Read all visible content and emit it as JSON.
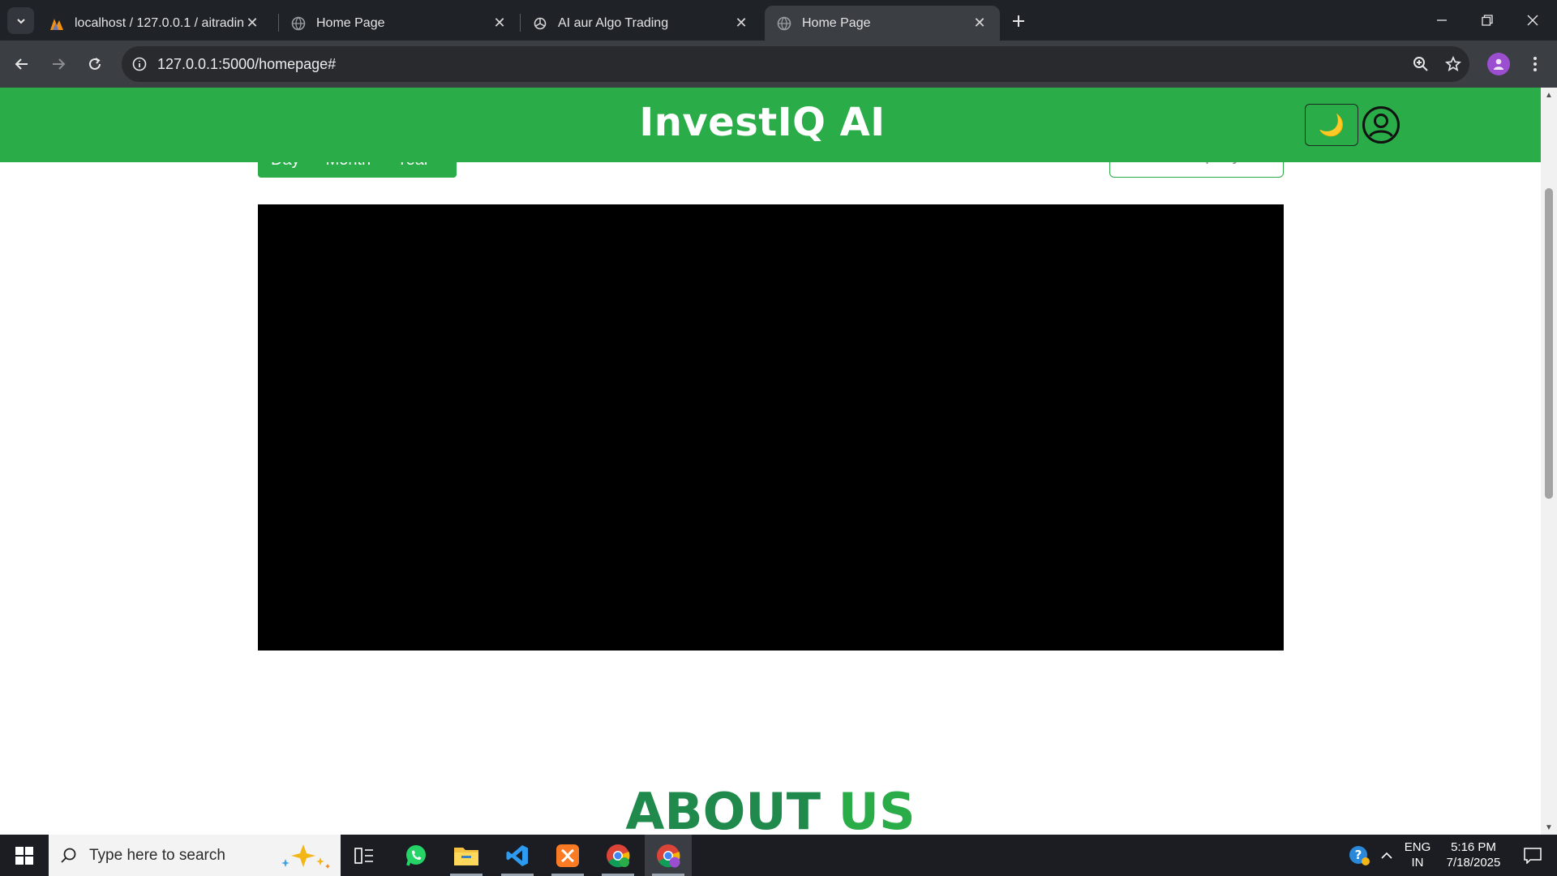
{
  "browser": {
    "tabs": [
      {
        "title": "localhost / 127.0.0.1 / aitrading",
        "favicon": "phpmyadmin-icon",
        "active": false
      },
      {
        "title": "Home Page",
        "favicon": "globe-icon",
        "active": false
      },
      {
        "title": "AI aur Algo Trading",
        "favicon": "openai-icon",
        "active": false
      },
      {
        "title": "Home Page",
        "favicon": "globe-icon",
        "active": true
      }
    ],
    "url": "127.0.0.1:5000/homepage#"
  },
  "app": {
    "brand": "InvestIQ AI",
    "theme_toggle_glyph": "🌙",
    "range_options": [
      "Day",
      "Month",
      "Year"
    ],
    "company_select_placeholder": "Select Company",
    "about_title_1": "ABOUT",
    "about_title_2": "US",
    "colors": {
      "brand_green": "#2aac48",
      "about_dark_green": "#1f8a4c"
    }
  },
  "taskbar": {
    "search_placeholder": "Type here to search",
    "apps": [
      "task-view-icon",
      "whatsapp-icon",
      "file-explorer-icon",
      "vscode-icon",
      "xampp-icon",
      "chrome-icon",
      "chrome-profile-icon"
    ],
    "lang_line1": "ENG",
    "lang_line2": "IN",
    "time": "5:16 PM",
    "date": "7/18/2025"
  }
}
